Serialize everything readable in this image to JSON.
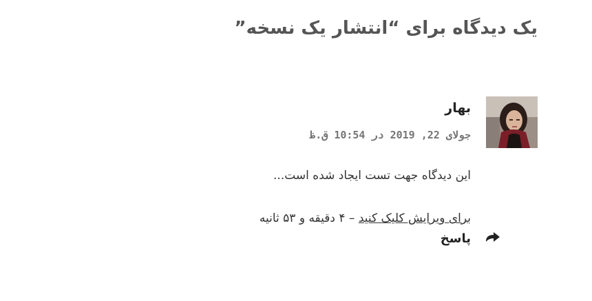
{
  "page": {
    "title": "یک دیدگاه برای “انتشار یک نسخه”"
  },
  "comment": {
    "author": "بهار",
    "date": "جولای 22, 2019 در 10:54 ق.ظ",
    "text": "این دیدگاه جهت تست ایجاد شده است...",
    "edit_link_label": "برای ویرایش کلیک کنید",
    "edit_time_note": " – ۴ دقیقه و ۵۳ ثانیه",
    "reply_label": "پاسخ",
    "reply_icon": "reply-arrow-icon",
    "avatar_icon": "user-avatar-photo"
  }
}
